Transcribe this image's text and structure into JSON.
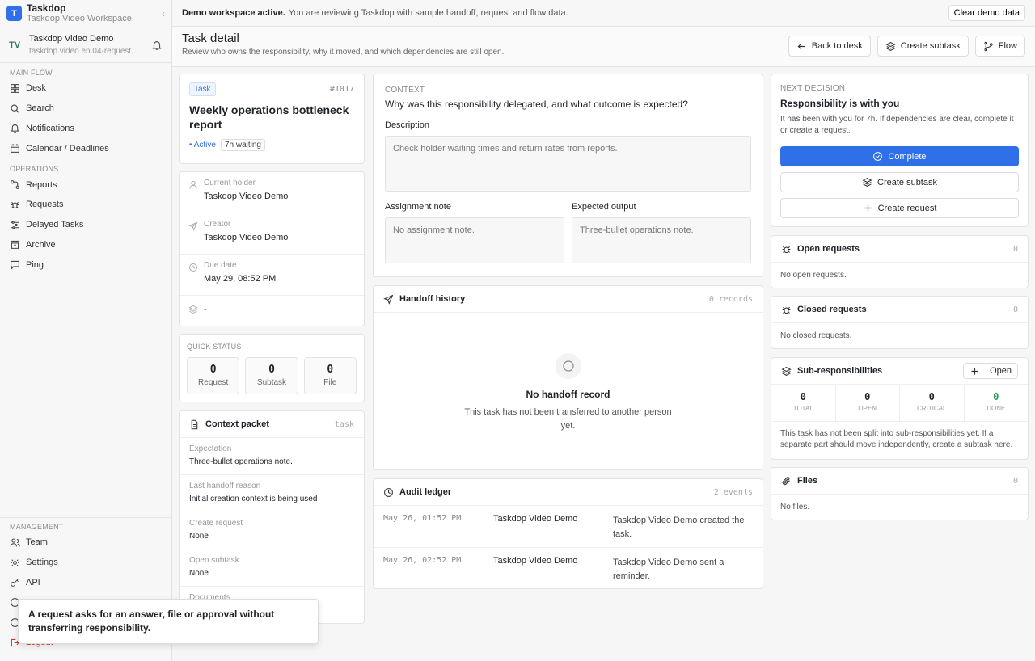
{
  "brand": {
    "logo": "T",
    "title": "Taskdop",
    "subtitle": "Taskdop Video Workspace"
  },
  "user": {
    "initials": "TV",
    "name": "Taskdop Video Demo",
    "sub": "taskdop.video.en.04-request..."
  },
  "sidebar": {
    "main_label": "MAIN FLOW",
    "main_items": [
      {
        "label": "Desk",
        "icon": "grid-icon"
      },
      {
        "label": "Search",
        "icon": "search-icon"
      },
      {
        "label": "Notifications",
        "icon": "bell-icon"
      },
      {
        "label": "Calendar / Deadlines",
        "icon": "calendar-icon"
      }
    ],
    "ops_label": "OPERATIONS",
    "ops_items": [
      {
        "label": "Reports",
        "icon": "nodes-icon"
      },
      {
        "label": "Requests",
        "icon": "bug-icon"
      },
      {
        "label": "Delayed Tasks",
        "icon": "sliders-icon"
      },
      {
        "label": "Archive",
        "icon": "archive-icon"
      },
      {
        "label": "Ping",
        "icon": "message-icon"
      }
    ],
    "mgmt_label": "MANAGEMENT",
    "mgmt_items": [
      {
        "label": "Team",
        "icon": "users-icon"
      },
      {
        "label": "Settings",
        "icon": "gear-icon"
      },
      {
        "label": "API",
        "icon": "key-icon"
      }
    ],
    "logout": "Logout"
  },
  "topbar": {
    "bold": "Demo workspace active.",
    "message": "You are reviewing Taskdop with sample handoff, request and flow data.",
    "clear_label": "Clear demo data"
  },
  "header": {
    "title": "Task detail",
    "subtitle": "Review who owns the responsibility, why it moved, and which dependencies are still open.",
    "back_label": "Back to desk",
    "subtask_label": "Create subtask",
    "flow_label": "Flow"
  },
  "task": {
    "badge": "Task",
    "id": "#1017",
    "title": "Weekly operations bottleneck report",
    "status": "• Active",
    "waiting": "7h waiting"
  },
  "meta": {
    "holder_label": "Current holder",
    "holder": "Taskdop Video Demo",
    "creator_label": "Creator",
    "creator": "Taskdop Video Demo",
    "due_label": "Due date",
    "due": "May 29, 08:52 PM",
    "layers_value": "-"
  },
  "quick_status": {
    "label": "QUICK STATUS",
    "items": [
      {
        "num": "0",
        "label": "Request"
      },
      {
        "num": "0",
        "label": "Subtask"
      },
      {
        "num": "0",
        "label": "File"
      }
    ]
  },
  "context_packet": {
    "title": "Context packet",
    "tag": "task",
    "rows": [
      {
        "label": "Expectation",
        "value": "Three-bullet operations note."
      },
      {
        "label": "Last handoff reason",
        "value": "Initial creation context is being used"
      },
      {
        "label": "Create request",
        "value": "None"
      },
      {
        "label": "Open subtask",
        "value": "None"
      },
      {
        "label": "Documents",
        "value": ""
      }
    ]
  },
  "context": {
    "kicker": "CONTEXT",
    "question": "Why was this responsibility delegated, and what outcome is expected?",
    "desc_label": "Description",
    "desc_value": "Check holder waiting times and return rates from reports.",
    "note_label": "Assignment note",
    "note_value": "No assignment note.",
    "output_label": "Expected output",
    "output_value": "Three-bullet operations note."
  },
  "handoff": {
    "title": "Handoff history",
    "count": "0 records",
    "empty_title": "No handoff record",
    "empty_text": "This task has not been transferred to another person yet."
  },
  "audit": {
    "title": "Audit ledger",
    "count": "2 events",
    "rows": [
      {
        "time": "May 26, 01:52 PM",
        "actor": "Taskdop Video Demo",
        "text": "Taskdop Video Demo created the task."
      },
      {
        "time": "May 26, 02:52 PM",
        "actor": "Taskdop Video Demo",
        "text": "Taskdop Video Demo sent a reminder."
      }
    ]
  },
  "decision": {
    "kicker": "NEXT DECISION",
    "title": "Responsibility is with you",
    "text": "It has been with you for 7h. If dependencies are clear, complete it or create a request.",
    "complete_label": "Complete",
    "subtask_label": "Create subtask",
    "request_label": "Create request"
  },
  "open_requests": {
    "title": "Open requests",
    "count": "0",
    "empty": "No open requests."
  },
  "closed_requests": {
    "title": "Closed requests",
    "count": "0",
    "empty": "No closed requests."
  },
  "sub_resp": {
    "title": "Sub-responsibilities",
    "open_label": "Open",
    "cells": [
      {
        "num": "0",
        "label": "TOTAL"
      },
      {
        "num": "0",
        "label": "OPEN"
      },
      {
        "num": "0",
        "label": "CRITICAL"
      },
      {
        "num": "0",
        "label": "DONE"
      }
    ],
    "text": "This task has not been split into sub-responsibilities yet. If a separate part should move independently, create a subtask here."
  },
  "files": {
    "title": "Files",
    "count": "0",
    "empty": "No files."
  },
  "tooltip": {
    "text": "A request asks for an answer, file or approval without transferring responsibility."
  },
  "colors": {
    "accent": "#2f6fe8",
    "done": "#2c9a5b",
    "logout": "#d2352c"
  }
}
